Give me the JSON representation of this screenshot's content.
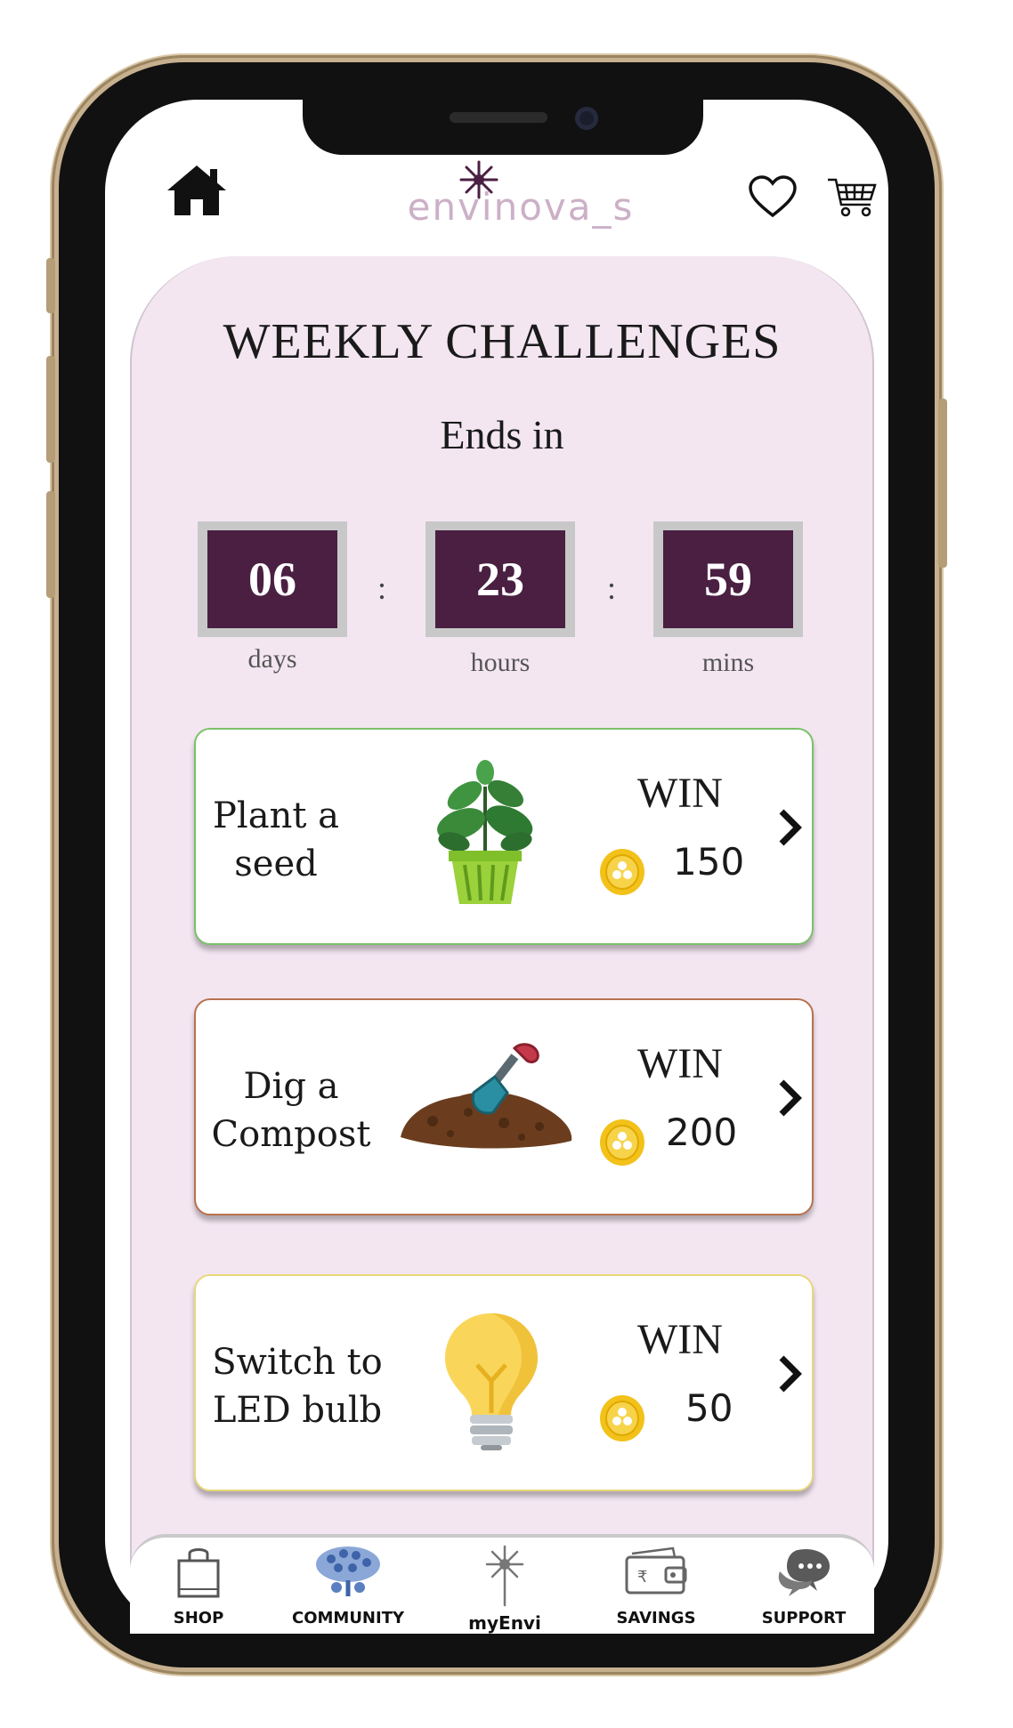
{
  "header": {
    "logo_text": "envinova_s",
    "home_icon": "home-icon",
    "wishlist_icon": "heart-icon",
    "cart_icon": "cart-icon"
  },
  "challenge_page": {
    "title": "WEEKLY CHALLENGES",
    "ends_in": "Ends in",
    "separator": ":",
    "timer": [
      {
        "value": "06",
        "unit": "days"
      },
      {
        "value": "23",
        "unit": "hours"
      },
      {
        "value": "59",
        "unit": "mins"
      }
    ]
  },
  "challenges": [
    {
      "label": "Plant a\nseed",
      "win": "WIN",
      "points": "150",
      "border": "#7cc06b",
      "illustration": "plant-pot-icon"
    },
    {
      "label": "Dig a\nCompost",
      "win": "WIN",
      "points": "200",
      "border": "#b7724f",
      "illustration": "compost-shovel-icon"
    },
    {
      "label": "Switch to\nLED bulb",
      "win": "WIN",
      "points": "50",
      "border": "#e9d77a",
      "illustration": "light-bulb-icon"
    }
  ],
  "bottom_nav": [
    {
      "label": "SHOP",
      "icon": "shopping-bag-icon"
    },
    {
      "label": "COMMUNITY",
      "icon": "community-tree-icon"
    },
    {
      "label": "myEnvi",
      "icon": "dandelion-icon"
    },
    {
      "label": "SAVINGS",
      "icon": "wallet-icon"
    },
    {
      "label": "SUPPORT",
      "icon": "chat-bubbles-icon"
    }
  ],
  "colors": {
    "panel_bg": "#f3e6f1",
    "timer_bg": "#4a1f42",
    "coin": "#f2c21a",
    "logo": "#cbb0c7"
  }
}
